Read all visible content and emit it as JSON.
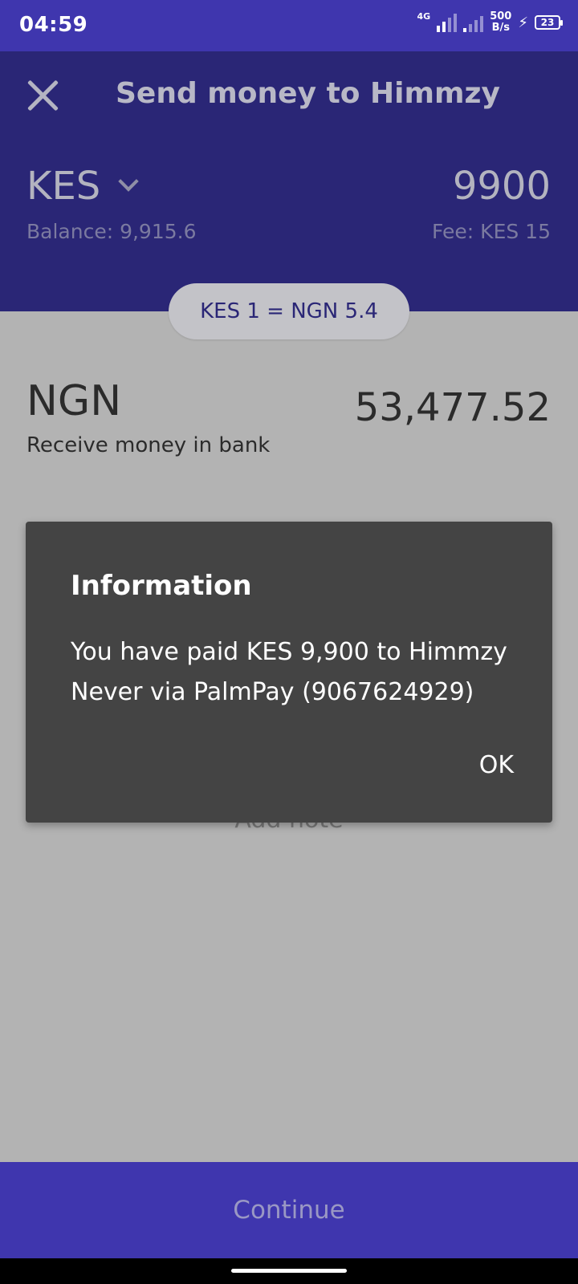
{
  "status_bar": {
    "time": "04:59",
    "network": "4G",
    "speed_value": "500",
    "speed_unit": "B/s",
    "battery": "23"
  },
  "header": {
    "title": "Send money to Himmzy",
    "close_icon": "close-icon",
    "send_currency": "KES",
    "send_amount": "9900",
    "balance": "Balance: 9,915.6",
    "fee": "Fee: KES 15"
  },
  "rate": "KES 1 = NGN 5.4",
  "receive": {
    "currency": "NGN",
    "amount": "53,477.52",
    "method": "Receive money in bank"
  },
  "note": {
    "label": "Add note"
  },
  "dialog": {
    "title": "Information",
    "message": "You have paid KES 9,900 to Himmzy Never via PalmPay (9067624929)",
    "ok_label": "OK"
  },
  "footer": {
    "continue_label": "Continue"
  },
  "colors": {
    "primary": "#3f36ae",
    "header": "#2a2676",
    "dialog": "#444444",
    "scrim_bg": "#b3b3b3"
  }
}
